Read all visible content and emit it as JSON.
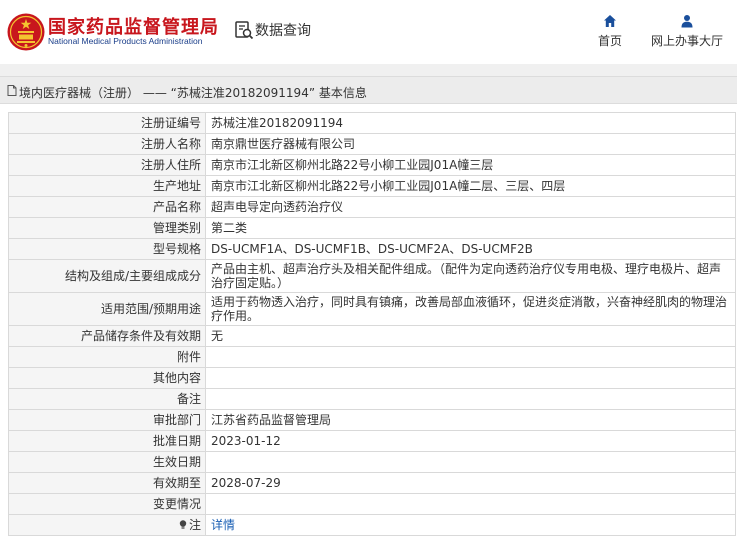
{
  "header": {
    "title_cn": "国家药品监督管理局",
    "title_en": "National Medical Products Administration",
    "query_label": "数据查询",
    "nav": [
      {
        "label": "首页",
        "icon": "home-icon"
      },
      {
        "label": "网上办事大厅",
        "icon": "user-icon"
      }
    ]
  },
  "breadcrumb": {
    "text": "境内医疗器械（注册） —— “苏械注准20182091194”  基本信息"
  },
  "record": {
    "rows": [
      {
        "key": "注册证编号",
        "value": "苏械注准20182091194"
      },
      {
        "key": "注册人名称",
        "value": "南京鼎世医疗器械有限公司"
      },
      {
        "key": "注册人住所",
        "value": "南京市江北新区柳州北路22号小柳工业园J01A幢三层"
      },
      {
        "key": "生产地址",
        "value": "南京市江北新区柳州北路22号小柳工业园J01A幢二层、三层、四层"
      },
      {
        "key": "产品名称",
        "value": "超声电导定向透药治疗仪"
      },
      {
        "key": "管理类别",
        "value": "第二类"
      },
      {
        "key": "型号规格",
        "value": "DS-UCMF1A、DS-UCMF1B、DS-UCMF2A、DS-UCMF2B"
      },
      {
        "key": "结构及组成/主要组成成分",
        "value": "产品由主机、超声治疗头及相关配件组成。（配件为定向透药治疗仪专用电极、理疗电极片、超声治疗固定贴。）"
      },
      {
        "key": "适用范围/预期用途",
        "value": "适用于药物透入治疗，同时具有镇痛，改善局部血液循环，促进炎症消散，兴奋神经肌肉的物理治疗作用。"
      },
      {
        "key": "产品储存条件及有效期",
        "value": "无"
      },
      {
        "key": "附件",
        "value": ""
      },
      {
        "key": "其他内容",
        "value": ""
      },
      {
        "key": "备注",
        "value": ""
      },
      {
        "key": "审批部门",
        "value": "江苏省药品监督管理局"
      },
      {
        "key": "批准日期",
        "value": "2023-01-12"
      },
      {
        "key": "生效日期",
        "value": ""
      },
      {
        "key": "有效期至",
        "value": "2028-07-29"
      },
      {
        "key": "变更情况",
        "value": ""
      },
      {
        "key": "注",
        "value": "详情"
      }
    ]
  },
  "colors": {
    "brand_red": "#c8161d",
    "brand_blue": "#1a3e8a",
    "link_blue": "#1a5fb4",
    "nav_icon_blue": "#1a4f9c"
  }
}
